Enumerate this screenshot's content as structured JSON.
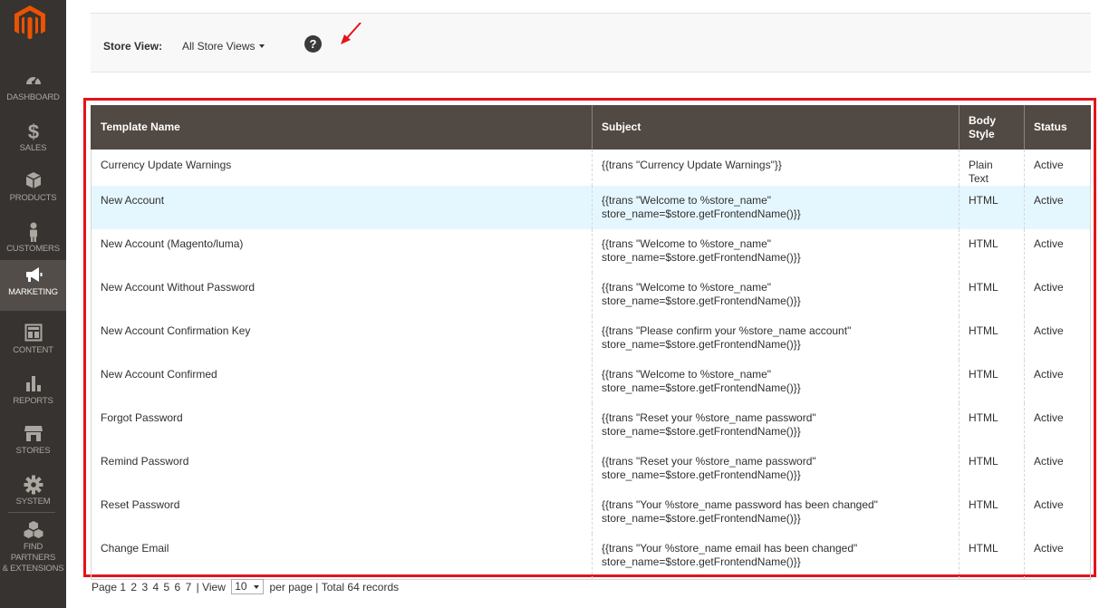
{
  "sidebar": {
    "items": [
      {
        "label": "DASHBOARD",
        "icon": "dashboard-icon"
      },
      {
        "label": "SALES",
        "icon": "dollar-icon"
      },
      {
        "label": "PRODUCTS",
        "icon": "box-icon"
      },
      {
        "label": "CUSTOMERS",
        "icon": "person-icon"
      },
      {
        "label": "MARKETING",
        "icon": "megaphone-icon"
      },
      {
        "label": "CONTENT",
        "icon": "layout-icon"
      },
      {
        "label": "REPORTS",
        "icon": "bar-chart-icon"
      },
      {
        "label": "STORES",
        "icon": "storefront-icon"
      },
      {
        "label": "SYSTEM",
        "icon": "gear-icon"
      }
    ],
    "partners_line1": "FIND PARTNERS",
    "partners_line2": "& EXTENSIONS"
  },
  "store_view": {
    "label": "Store View:",
    "value": "All Store Views"
  },
  "help_glyph": "?",
  "table": {
    "headers": {
      "name": "Template Name",
      "subject": "Subject",
      "body_line1": "Body",
      "body_line2": "Style",
      "status": "Status"
    },
    "rows": [
      {
        "name": "Currency Update Warnings",
        "subject1": "{{trans \"Currency Update Warnings\"}}",
        "subject2": "",
        "body": "Plain Text",
        "status": "Active"
      },
      {
        "name": "New Account",
        "subject1": "{{trans \"Welcome to %store_name\"",
        "subject2": "store_name=$store.getFrontendName()}}",
        "body": "HTML",
        "status": "Active"
      },
      {
        "name": "New Account (Magento/luma)",
        "subject1": "{{trans \"Welcome to %store_name\"",
        "subject2": "store_name=$store.getFrontendName()}}",
        "body": "HTML",
        "status": "Active"
      },
      {
        "name": "New Account Without Password",
        "subject1": "{{trans \"Welcome to %store_name\"",
        "subject2": "store_name=$store.getFrontendName()}}",
        "body": "HTML",
        "status": "Active"
      },
      {
        "name": "New Account Confirmation Key",
        "subject1": "{{trans \"Please confirm your %store_name account\"",
        "subject2": "store_name=$store.getFrontendName()}}",
        "body": "HTML",
        "status": "Active"
      },
      {
        "name": "New Account Confirmed",
        "subject1": "{{trans \"Welcome to %store_name\"",
        "subject2": "store_name=$store.getFrontendName()}}",
        "body": "HTML",
        "status": "Active"
      },
      {
        "name": "Forgot Password",
        "subject1": "{{trans \"Reset your %store_name password\"",
        "subject2": "store_name=$store.getFrontendName()}}",
        "body": "HTML",
        "status": "Active"
      },
      {
        "name": "Remind Password",
        "subject1": "{{trans \"Reset your %store_name password\"",
        "subject2": "store_name=$store.getFrontendName()}}",
        "body": "HTML",
        "status": "Active"
      },
      {
        "name": "Reset Password",
        "subject1": "{{trans \"Your %store_name password has been changed\"",
        "subject2": "store_name=$store.getFrontendName()}}",
        "body": "HTML",
        "status": "Active"
      },
      {
        "name": "Change Email",
        "subject1": "{{trans \"Your %store_name email has been changed\"",
        "subject2": "store_name=$store.getFrontendName()}}",
        "body": "HTML",
        "status": "Active"
      }
    ]
  },
  "pager": {
    "page_label": "Page",
    "pages": [
      "1",
      "2",
      "3",
      "4",
      "5",
      "6",
      "7"
    ],
    "sep1": "|",
    "view_label": "View",
    "per_page_value": "10",
    "per_page_label": "per page",
    "sep2": "|",
    "total_label": "Total 64 records"
  },
  "colors": {
    "sidebar_bg": "#373330",
    "header_bg": "#514943",
    "highlight_frame": "#e2141b",
    "logo": "#eb5202",
    "row_highlight": "#e5f7fe"
  }
}
